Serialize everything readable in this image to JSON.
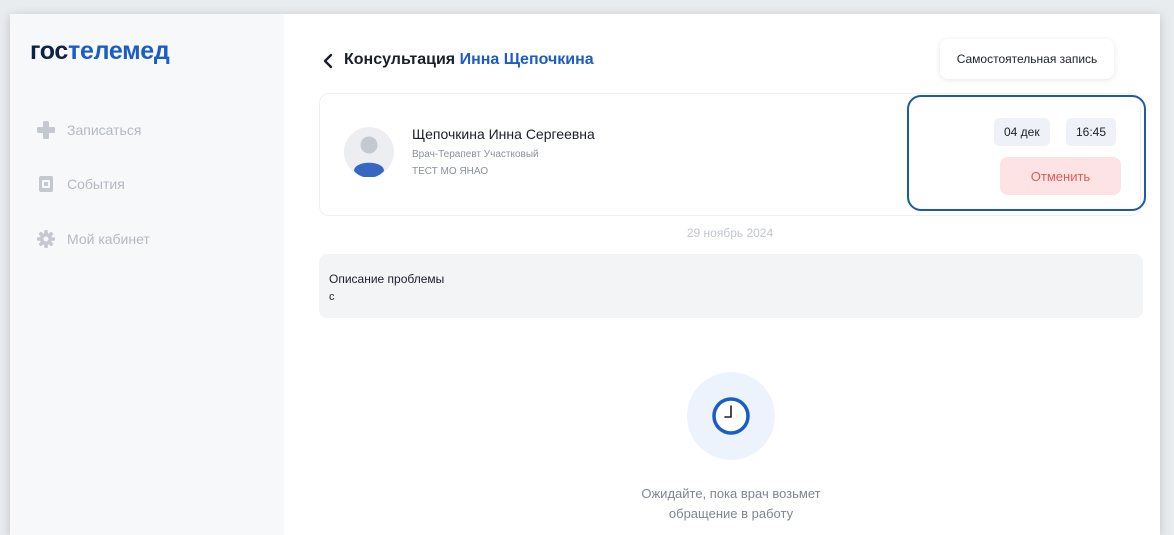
{
  "brand": {
    "part1": "гос",
    "part2": "телемед"
  },
  "sidebar": {
    "items": [
      {
        "label": "Записаться",
        "icon": "plus-icon"
      },
      {
        "label": "События",
        "icon": "calendar-icon"
      },
      {
        "label": "Мой кабинет",
        "icon": "gear-icon"
      }
    ]
  },
  "header": {
    "title_prefix": "Консультация",
    "title_doctor": "Инна Щепочкина",
    "self_record_label": "Самостоятельная запись"
  },
  "doctor": {
    "name": "Щепочкина Инна Сергеевна",
    "role": "Врач-Терапевт Участковый",
    "org": "ТЕСТ МО ЯНАО"
  },
  "appointment": {
    "date": "04 дек",
    "time": "16:45",
    "cancel_label": "Отменить"
  },
  "date_separator": "29 ноябрь 2024",
  "problem": {
    "label": "Описание проблемы",
    "value": "с"
  },
  "status": {
    "line1": "Ожидайте, пока врач возьмет",
    "line2": "обращение в работу"
  },
  "colors": {
    "accent": "#1b5cc5",
    "brand_dark": "#0f2147",
    "cancel_bg": "#fde3e3",
    "cancel_text": "#e25b5b",
    "highlight": "#1e5aa8"
  }
}
